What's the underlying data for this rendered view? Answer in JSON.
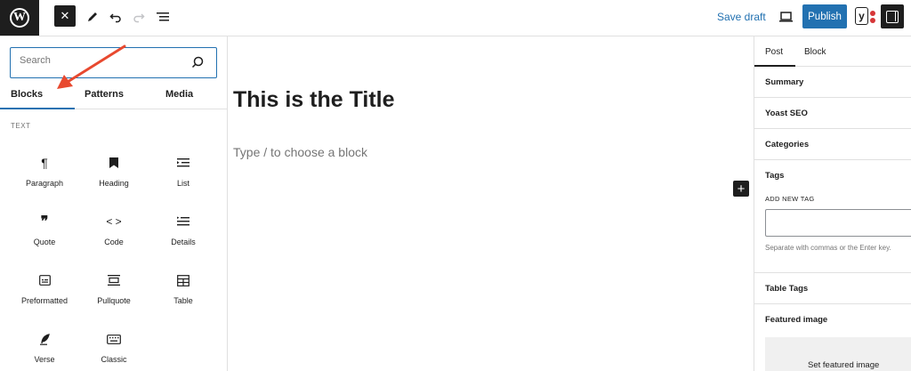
{
  "topbar": {
    "logo_icon": "wordpress-logo-icon",
    "close_icon": "close-icon",
    "tools_icon": "pencil-icon",
    "undo_icon": "undo-icon",
    "redo_icon": "redo-icon",
    "outline_icon": "list-view-icon",
    "save_draft": "Save draft",
    "preview_icon": "desktop-icon",
    "publish": "Publish",
    "yoast_icon": "yoast-icon",
    "settings_icon": "sidebar-toggle-icon"
  },
  "inserter": {
    "search_placeholder": "Search",
    "tabs": [
      {
        "label": "Blocks"
      },
      {
        "label": "Patterns"
      },
      {
        "label": "Media"
      }
    ],
    "section_label": "TEXT",
    "blocks": [
      {
        "label": "Paragraph",
        "icon": "paragraph-icon"
      },
      {
        "label": "Heading",
        "icon": "heading-icon"
      },
      {
        "label": "List",
        "icon": "list-icon"
      },
      {
        "label": "Quote",
        "icon": "quote-icon"
      },
      {
        "label": "Code",
        "icon": "code-icon"
      },
      {
        "label": "Details",
        "icon": "details-icon"
      },
      {
        "label": "Preformatted",
        "icon": "preformatted-icon"
      },
      {
        "label": "Pullquote",
        "icon": "pullquote-icon"
      },
      {
        "label": "Table",
        "icon": "table-icon"
      },
      {
        "label": "Verse",
        "icon": "verse-icon"
      },
      {
        "label": "Classic",
        "icon": "keyboard-icon"
      }
    ]
  },
  "editor": {
    "title": "This is the Title",
    "block_placeholder": "Type / to choose a block",
    "add_block_icon": "plus-icon"
  },
  "sidebar": {
    "tabs": [
      {
        "label": "Post"
      },
      {
        "label": "Block"
      }
    ],
    "panels": {
      "summary": "Summary",
      "yoast": "Yoast SEO",
      "categories": "Categories",
      "tags": "Tags",
      "table_tags": "Table Tags",
      "featured_image": "Featured image"
    },
    "add_new_tag_label": "ADD NEW TAG",
    "tag_help": "Separate with commas or the Enter key.",
    "set_featured_image": "Set featured image"
  },
  "colors": {
    "accent": "#2271b1",
    "dark": "#1e1e1e",
    "annotation_arrow": "#e8492f"
  }
}
